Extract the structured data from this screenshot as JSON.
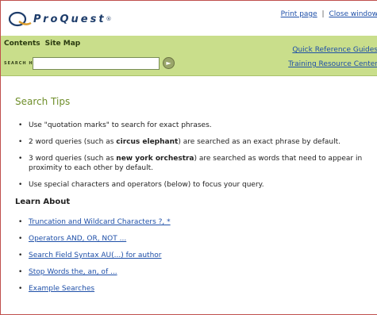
{
  "header": {
    "logo_text": "ProQuest",
    "logo_registered": "®",
    "print_page": "Print page",
    "separator": "|",
    "close_window": "Close window"
  },
  "navbar": {
    "tab_contents": "Contents",
    "tab_site_map": "Site Map",
    "search_label": "SEARCH HELP",
    "search_value": "",
    "go_label": "Go",
    "quick_reference": "Quick Reference Guides",
    "training": "Training Resource Center"
  },
  "main": {
    "title": "Search Tips",
    "tips": [
      {
        "before": "Use \"quotation marks\" to search for exact phrases.",
        "bold": "",
        "after": ""
      },
      {
        "before": "2 word queries (such as ",
        "bold": "circus elephant",
        "after": ") are searched as an exact phrase by default."
      },
      {
        "before": "3 word queries (such as ",
        "bold": "new york orchestra",
        "after": ") are searched as words that need to appear in proximity to each other by default."
      },
      {
        "before": "Use special characters and operators (below) to focus your query.",
        "bold": "",
        "after": ""
      }
    ],
    "learn_title": "Learn About",
    "links": [
      "Truncation and Wildcard Characters ?, *",
      "Operators AND, OR, NOT ...",
      "Search Field Syntax AU(...) for author",
      "Stop Words the, an, of ...",
      "Example Searches"
    ]
  },
  "colors": {
    "nav_green": "#c9de8b",
    "title_green": "#6f8e2a",
    "link_blue": "#1e4fa8",
    "logo_blue": "#1e3d6b",
    "frame_red": "#c0504d"
  }
}
